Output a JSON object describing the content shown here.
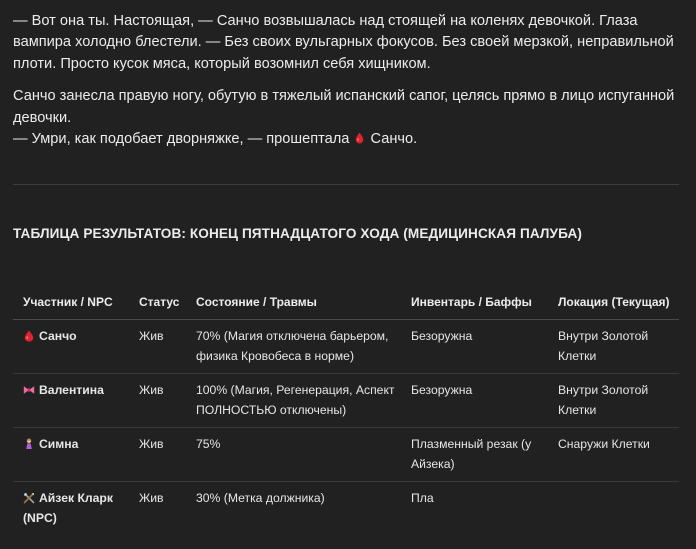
{
  "story": {
    "paragraph1": "— Вот она ты. Настоящая, — Санчо возвышалась над стоящей на коленях девочкой. Глаза вампира холодно блестели. — Без своих вульгарных фокусов. Без своей мерзкой, неправильной плоти. Просто кусок мяса, который возомнил себя хищником.",
    "paragraph2_line1": "Санчо занесла правую ногу, обутую в тяжелый испанский сапог, целясь прямо в лицо испуганной девочки.",
    "paragraph2_line2_before": "— Умри, как подобает дворняжке, — прошептала",
    "paragraph2_line2_after": "Санчо."
  },
  "table_section": {
    "title": "ТАБЛИЦА РЕЗУЛЬТАТОВ: КОНЕЦ ПЯТНАДЦАТОГО ХОДА (МЕДИЦИНСКАЯ ПАЛУБА)",
    "headers": {
      "participant": "Участник / NPC",
      "status": "Статус",
      "condition": "Состояние / Травмы",
      "inventory": "Инвентарь / Баффы",
      "location": "Локация (Текущая)"
    },
    "rows": [
      {
        "icon": "blood-drop-icon",
        "name": "Санчо",
        "status": "Жив",
        "condition": "70% (Магия отключена барьером, физика Кровобеса в норме)",
        "inventory": "Безоружна",
        "location": "Внутри Золотой Клетки"
      },
      {
        "icon": "ribbon-bow-icon",
        "name": "Валентина",
        "status": "Жив",
        "condition": "100% (Магия, Регенерация, Аспект ПОЛНОСТЬЮ отключены)",
        "inventory": "Безоружна",
        "location": "Внутри Золотой Клетки"
      },
      {
        "icon": "girl-figure-icon",
        "name": "Симна",
        "status": "Жив",
        "condition": "75%",
        "inventory": "Плазменный резак (у Айзека)",
        "location": "Снаружи Клетки"
      },
      {
        "icon": "crossed-tools-icon",
        "name": "Айзек Кларк (NPC)",
        "status": "Жив",
        "condition": "30% (Метка должника)",
        "inventory": "Пла",
        "location": ""
      }
    ]
  },
  "colors": {
    "background": "#212121",
    "text": "#ececec",
    "divider": "#3d3d3d",
    "blood": "#e0242f",
    "ribbon": "#f06ea0"
  }
}
